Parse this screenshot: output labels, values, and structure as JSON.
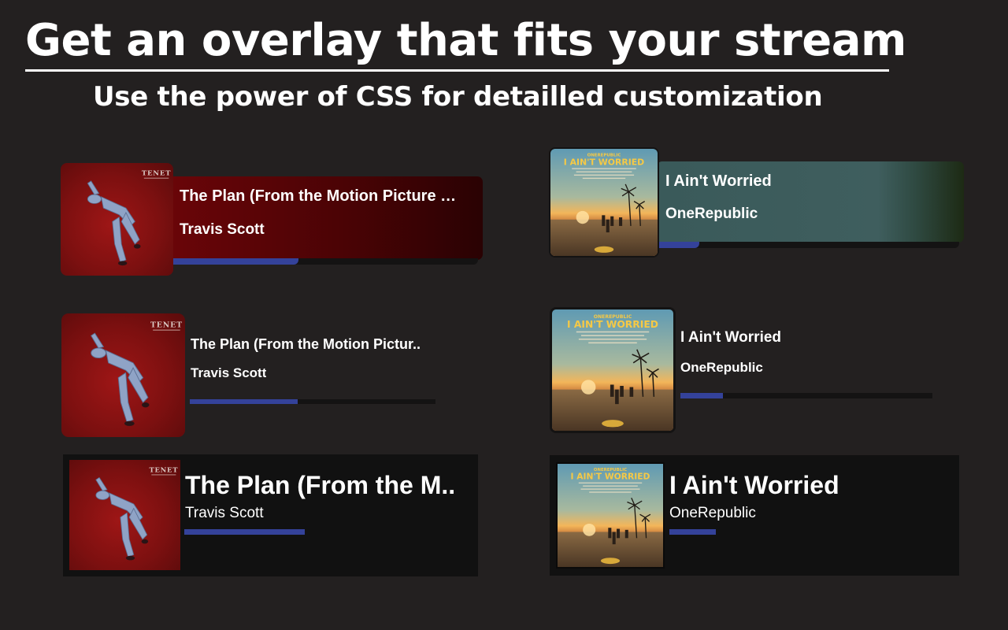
{
  "header": {
    "title": "Get an overlay that fits your stream",
    "subtitle": "Use the power of CSS for detailled customization"
  },
  "colors": {
    "background": "#232020",
    "progress_fill": "#34429a",
    "progress_track": "#141313",
    "box_background": "#111111",
    "tenet_panel": "#4b0305",
    "worried_panel": "#3f5e5e"
  },
  "cards": [
    {
      "style": "gradient-panel",
      "title": "The Plan (From the Motion Picture \"TENET\")",
      "artist": "Travis Scott",
      "art": "tenet-album-art",
      "progress": 0.42
    },
    {
      "style": "gradient-panel",
      "title": "I Ain't Worried",
      "artist": "OneRepublic",
      "art": "i-aint-worried-album-art",
      "progress": 0.14
    },
    {
      "style": "minimal",
      "title": "The Plan (From the Motion Pictur..",
      "artist": "Travis Scott",
      "art": "tenet-album-art",
      "progress": 0.44
    },
    {
      "style": "minimal",
      "title": "I Ain't Worried",
      "artist": "OneRepublic",
      "art": "i-aint-worried-album-art",
      "progress": 0.17
    },
    {
      "style": "box",
      "title": "The Plan (From the M..",
      "artist": "Travis Scott",
      "art": "tenet-album-art",
      "progress": 0.29
    },
    {
      "style": "box",
      "title": "I Ain't Worried",
      "artist": "OneRepublic",
      "art": "i-aint-worried-album-art",
      "progress": 0.11
    }
  ],
  "album_art_text": {
    "tenet": "TENET",
    "onerepublic": "ONEREPUBLIC",
    "worried": "I AIN'T WORRIED"
  }
}
